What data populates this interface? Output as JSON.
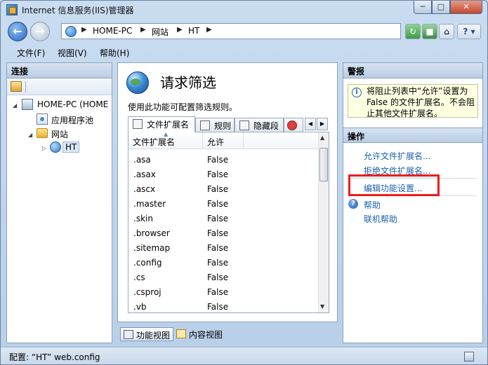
{
  "window": {
    "title": "Internet 信息服务(IIS)管理器"
  },
  "address": {
    "segments": [
      "HOME-PC",
      "网站",
      "HT"
    ]
  },
  "menu": [
    "文件(F)",
    "视图(V)",
    "帮助(H)"
  ],
  "connections": {
    "header": "连接",
    "tree": {
      "server": "HOME-PC (HOME",
      "app_pools": "应用程序池",
      "sites": "网站",
      "site_ht": "HT"
    }
  },
  "feature": {
    "title": "请求筛选",
    "description": "使用此功能可配置筛选规则。",
    "tabs": [
      "文件扩展名",
      "规则",
      "隐藏段"
    ],
    "columns": [
      "文件扩展名",
      "允许"
    ],
    "rows": [
      [
        ".asa",
        "False"
      ],
      [
        ".asax",
        "False"
      ],
      [
        ".ascx",
        "False"
      ],
      [
        ".master",
        "False"
      ],
      [
        ".skin",
        "False"
      ],
      [
        ".browser",
        "False"
      ],
      [
        ".sitemap",
        "False"
      ],
      [
        ".config",
        "False"
      ],
      [
        ".cs",
        "False"
      ],
      [
        ".csproj",
        "False"
      ],
      [
        ".vb",
        "False"
      ]
    ]
  },
  "view_tabs": [
    "功能视图",
    "内容视图"
  ],
  "alerts": {
    "header": "警报",
    "message": "将阻止列表中“允许”设置为 False 的文件扩展名。不会阻止其他文件扩展名。"
  },
  "actions": {
    "header": "操作",
    "items": [
      "允许文件扩展名...",
      "拒绝文件扩展名...",
      "编辑功能设置..."
    ],
    "help": "帮助",
    "online_help": "联机帮助"
  },
  "status": {
    "text": "配置: “HT” web.config"
  },
  "colors": {
    "highlight": "#ee1c1c",
    "link": "#1b5fae"
  }
}
